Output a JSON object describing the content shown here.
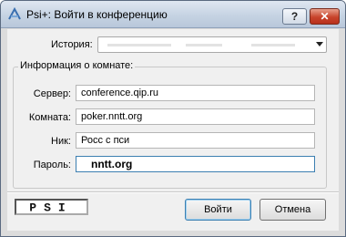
{
  "window": {
    "title": "Psi+: Войти в конференцию",
    "help_label": "?",
    "close_label": "✕"
  },
  "history": {
    "label": "История:",
    "value": ""
  },
  "room_info": {
    "title": "Информация о комнате:",
    "fields": [
      {
        "label": "Сервер:",
        "value": "conference.qip.ru"
      },
      {
        "label": "Комната:",
        "value": "poker.nntt.org"
      },
      {
        "label": "Ник:",
        "value": "Росс с пси"
      },
      {
        "label": "Пароль:",
        "value": "nntt.org"
      }
    ]
  },
  "logo": {
    "text": "PSI",
    "icon": "psi-logo-icon"
  },
  "buttons": {
    "ok": "Войти",
    "cancel": "Отмена"
  },
  "colors": {
    "accent": "#3c7fb1",
    "close": "#c8442c"
  }
}
